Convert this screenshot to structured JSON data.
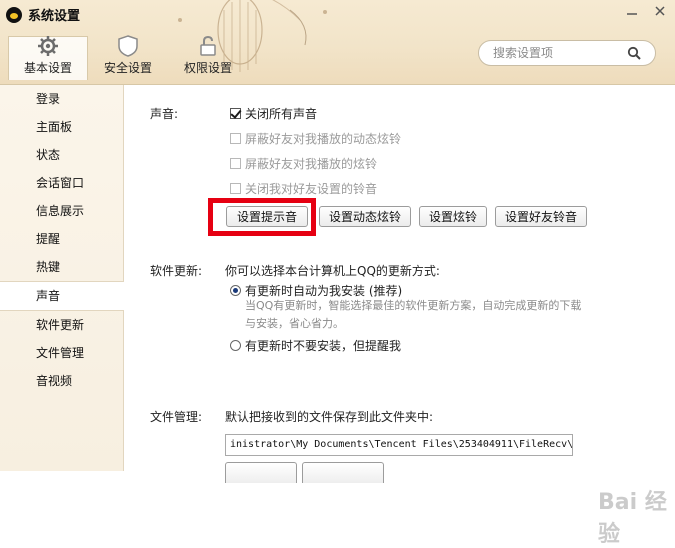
{
  "window": {
    "title": "系统设置",
    "minimize_icon": "minimize-icon",
    "close_icon": "close-icon"
  },
  "tabs": [
    {
      "label": "基本设置",
      "icon": "gear-icon",
      "active": true
    },
    {
      "label": "安全设置",
      "icon": "shield-icon",
      "active": false
    },
    {
      "label": "权限设置",
      "icon": "lock-icon",
      "active": false
    }
  ],
  "search": {
    "placeholder": "搜索设置项",
    "icon": "search-icon"
  },
  "sidebar": {
    "items": [
      {
        "label": "登录"
      },
      {
        "label": "主面板"
      },
      {
        "label": "状态"
      },
      {
        "label": "会话窗口"
      },
      {
        "label": "信息展示"
      },
      {
        "label": "提醒"
      },
      {
        "label": "热键"
      },
      {
        "label": "声音",
        "active": true
      },
      {
        "label": "软件更新"
      },
      {
        "label": "文件管理"
      },
      {
        "label": "音视频"
      }
    ]
  },
  "sound": {
    "label": "声音:",
    "options": [
      {
        "label": "关闭所有声音",
        "checked": true,
        "disabled": false
      },
      {
        "label": "屏蔽好友对我播放的动态炫铃",
        "checked": false,
        "disabled": true
      },
      {
        "label": "屏蔽好友对我播放的炫铃",
        "checked": false,
        "disabled": true
      },
      {
        "label": "关闭我对好友设置的铃音",
        "checked": false,
        "disabled": true
      }
    ],
    "buttons": [
      "设置提示音",
      "设置动态炫铃",
      "设置炫铃",
      "设置好友铃音"
    ]
  },
  "update": {
    "label": "软件更新:",
    "intro": "你可以选择本台计算机上QQ的更新方式:",
    "option1": "有更新时自动为我安装 (推荐)",
    "option1_desc_line1": "当QQ有更新时，智能选择最佳的软件更新方案，自动完成更新的下载",
    "option1_desc_line2": "与安装，省心省力。",
    "option2": "有更新时不要安装，但提醒我",
    "selected": 1
  },
  "files": {
    "label": "文件管理:",
    "intro": "默认把接收到的文件保存到此文件夹中:",
    "path": "inistrator\\My Documents\\Tencent Files\\253404911\\FileRecv\\"
  },
  "watermark": "Bai 经验",
  "colors": {
    "highlight": "#e60012",
    "header_bg": "#f2e4c9",
    "sidebar_bg": "#f9f2e5"
  }
}
